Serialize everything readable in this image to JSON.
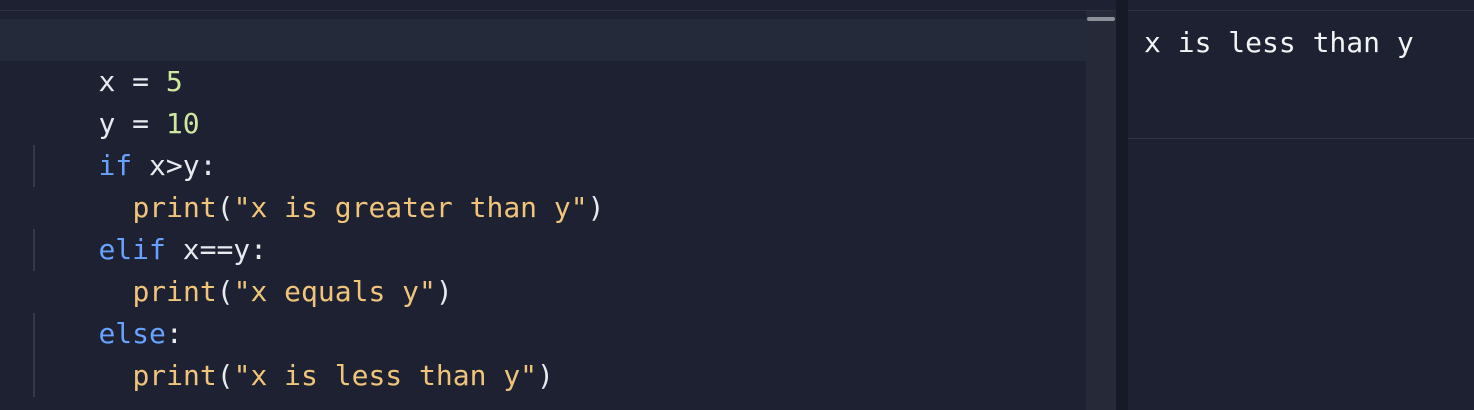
{
  "editor": {
    "lines": [
      {
        "t1": "x",
        "t2": " = ",
        "t3": "5"
      },
      {
        "t1": "y",
        "t2": " = ",
        "t3": "10"
      },
      {
        "kw": "if",
        "rest": " x>y:"
      },
      {
        "fn": "print",
        "open": "(",
        "str": "\"x is greater than y\"",
        "close": ")"
      },
      {
        "kw": "elif",
        "rest": " x==y:"
      },
      {
        "fn": "print",
        "open": "(",
        "str": "\"x equals y\"",
        "close": ")"
      },
      {
        "kw": "else",
        "rest": ":"
      },
      {
        "fn": "print",
        "open": "(",
        "str": "\"x is less than y\"",
        "close": ")"
      }
    ]
  },
  "output": {
    "text": "x is less than y"
  },
  "colors": {
    "background": "#1e2131",
    "keyword": "#68a2ff",
    "string": "#f0c57b",
    "number": "#d0e7a0",
    "text": "#e8eaf0"
  },
  "icons": []
}
